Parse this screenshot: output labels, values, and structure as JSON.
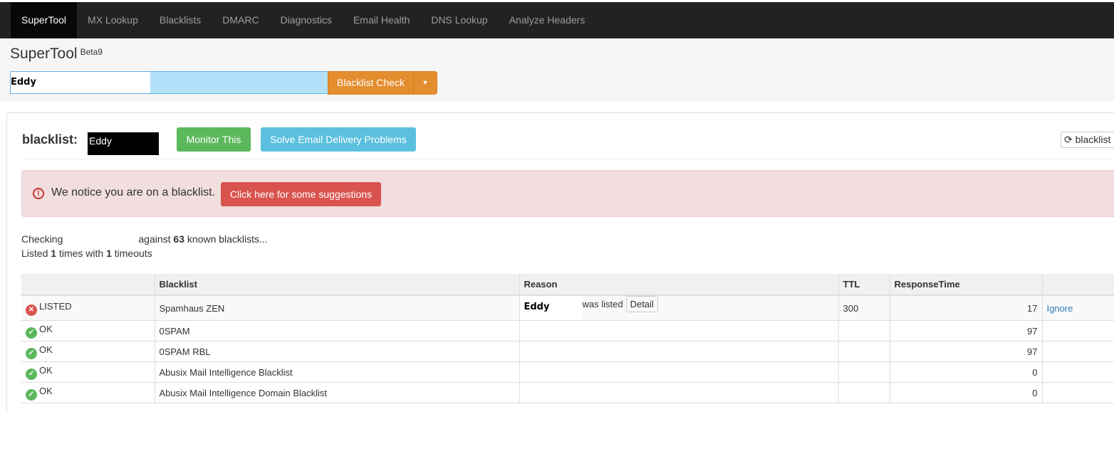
{
  "nav": {
    "items": [
      "SuperTool",
      "MX Lookup",
      "Blacklists",
      "DMARC",
      "Diagnostics",
      "Email Health",
      "DNS Lookup",
      "Analyze Headers"
    ]
  },
  "header": {
    "title": "SuperTool",
    "version": "Beta9",
    "search_value": "Eddy",
    "check_button": "Blacklist Check"
  },
  "result": {
    "label": "blacklist:",
    "target": "Eddy",
    "monitor_button": "Monitor This",
    "solve_button": "Solve Email Delivery Problems",
    "refresh_button": "blacklist"
  },
  "alert": {
    "text": "We notice you are on a blacklist.",
    "button": "Click here for some suggestions"
  },
  "summary": {
    "checking": "Checking",
    "against": "against",
    "count": "63",
    "known": "known blacklists...",
    "listed_pre": "Listed",
    "listed_count": "1",
    "times_with": "times with",
    "timeouts_count": "1",
    "timeouts": "timeouts"
  },
  "table": {
    "headers": [
      "",
      "Blacklist",
      "Reason",
      "TTL",
      "ResponseTime",
      ""
    ],
    "rows": [
      {
        "status": "LISTED",
        "blacklist": "Spamhaus ZEN",
        "reason_name": "Eddy",
        "reason": "was listed",
        "detail": "Detail",
        "ttl": "300",
        "response": "17",
        "action": "Ignore"
      },
      {
        "status": "OK",
        "blacklist": "0SPAM",
        "response": "97"
      },
      {
        "status": "OK",
        "blacklist": "0SPAM RBL",
        "response": "97"
      },
      {
        "status": "OK",
        "blacklist": "Abusix Mail Intelligence Blacklist",
        "response": "0"
      },
      {
        "status": "OK",
        "blacklist": "Abusix Mail Intelligence Domain Blacklist",
        "response": "0"
      }
    ]
  }
}
